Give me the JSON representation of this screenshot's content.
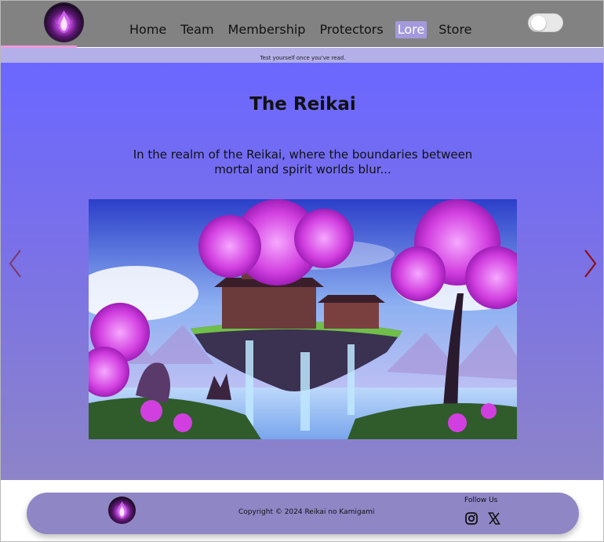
{
  "nav": {
    "items": [
      {
        "label": "Home",
        "active": false
      },
      {
        "label": "Team",
        "active": false
      },
      {
        "label": "Membership",
        "active": false
      },
      {
        "label": "Protectors",
        "active": false
      },
      {
        "label": "Lore",
        "active": true
      },
      {
        "label": "Store",
        "active": false
      }
    ],
    "theme_toggle": {
      "on": false
    }
  },
  "ticker": {
    "text": "Test yourself once you've read."
  },
  "main": {
    "title": "The Reikai",
    "subtitle": "In the realm of the Reikai, where the boundaries between mortal and spirit worlds blur...",
    "carousel": {
      "prev_icon": "chevron-left-icon",
      "next_icon": "chevron-right-icon"
    }
  },
  "footer": {
    "copyright": "Copyright © 2024 Reikai no Kamigami",
    "follow_label": "Follow Us",
    "social_icons": [
      "instagram-icon",
      "x-icon"
    ]
  },
  "colors": {
    "header_bg": "#828282",
    "active_nav": "#a29adc",
    "accent_underline": "#ef9ad8",
    "ticker_bg": "#b3afe8",
    "main_top": "#6b67ff",
    "main_bottom": "#8d84c8",
    "footer_bg": "#8e86c5",
    "prev_arrow": "#7a3a6a",
    "next_arrow": "#8b0f14"
  }
}
